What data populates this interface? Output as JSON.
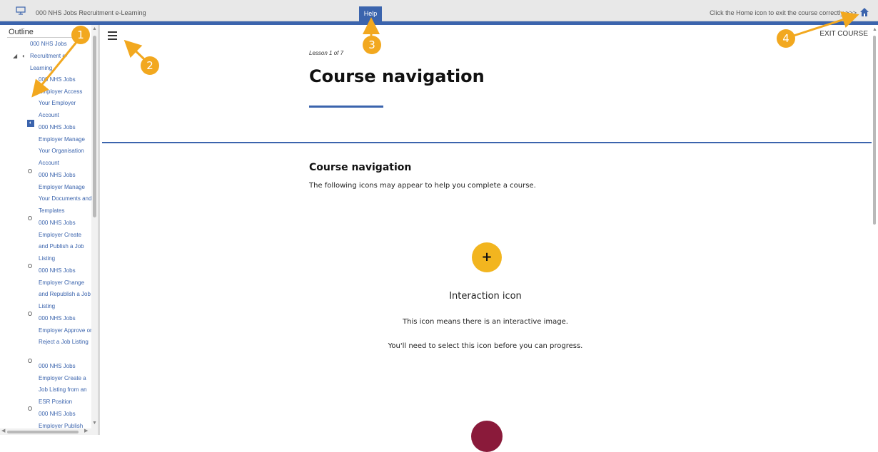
{
  "topbar": {
    "app_title": "000 NHS Jobs Recruitment e-Learning",
    "help_label": "Help",
    "home_hint": "Click the Home icon to exit the course correctly >>>"
  },
  "sidebar": {
    "title": "Outline",
    "items": [
      {
        "label": "000 NHS Jobs"
      },
      {
        "label": "Recruitment e-Learning"
      },
      {
        "label": "000 NHS Jobs Employer Access Your Employer Account"
      },
      {
        "label": "000 NHS Jobs Employer Manage Your Organisation Account"
      },
      {
        "label": "000 NHS Jobs Employer Manage Your Documents and Templates"
      },
      {
        "label": "000 NHS Jobs Employer Create and Publish a Job Listing"
      },
      {
        "label": "000 NHS Jobs Employer Change and Republish a Job Listing"
      },
      {
        "label": "000 NHS Jobs Employer Approve or Reject a Job Listing"
      },
      {
        "label": "000 NHS Jobs Employer Create a Job Listing from an ESR Position"
      },
      {
        "label": "000 NHS Jobs Employer Publish"
      }
    ]
  },
  "main": {
    "exit_label": "EXIT COURSE",
    "lesson_count": "Lesson 1 of 7",
    "lesson_title": "Course navigation",
    "section_heading": "Course navigation",
    "section_text": "The following icons may appear to help you complete a course.",
    "interaction_symbol": "+",
    "interaction_title": "Interaction icon",
    "interaction_text1": "This icon means there is an interactive image.",
    "interaction_text2": "You'll need to select this icon before you can progress."
  },
  "annotations": [
    "1",
    "2",
    "3",
    "4"
  ],
  "colors": {
    "accent": "#3b64ad",
    "badge": "#f2a81f",
    "interaction": "#f2b51f",
    "play": "#8a1a3a"
  }
}
